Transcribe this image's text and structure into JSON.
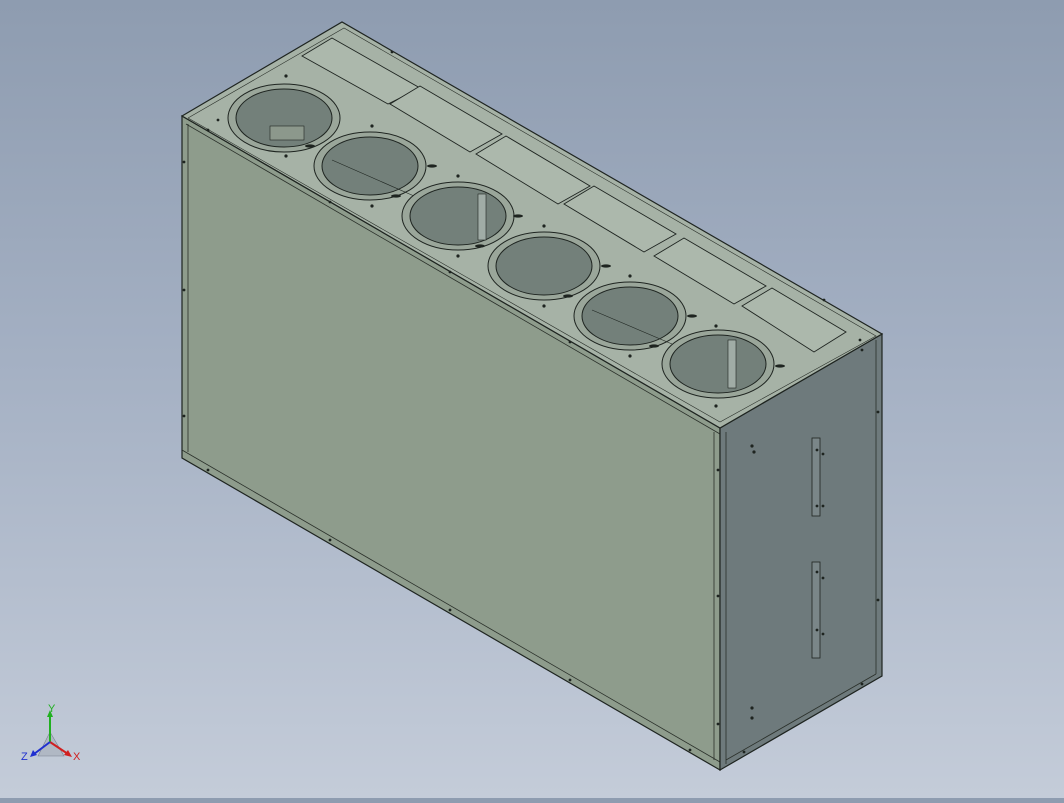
{
  "viewport": {
    "background_top": "#8e9cb0",
    "background_bottom": "#c4ccd9"
  },
  "model": {
    "front_face_color": "#8e9c8c",
    "side_face_color": "#6e7a7c",
    "top_face_color": "#a6b2a6",
    "edge_color": "#1e2420",
    "top_openings": 6,
    "top_cover_plates": 6
  },
  "triad": {
    "x_label": "X",
    "y_label": "Y",
    "z_label": "Z",
    "x_color": "#d02020",
    "y_color": "#20b020",
    "z_color": "#2030d0"
  }
}
